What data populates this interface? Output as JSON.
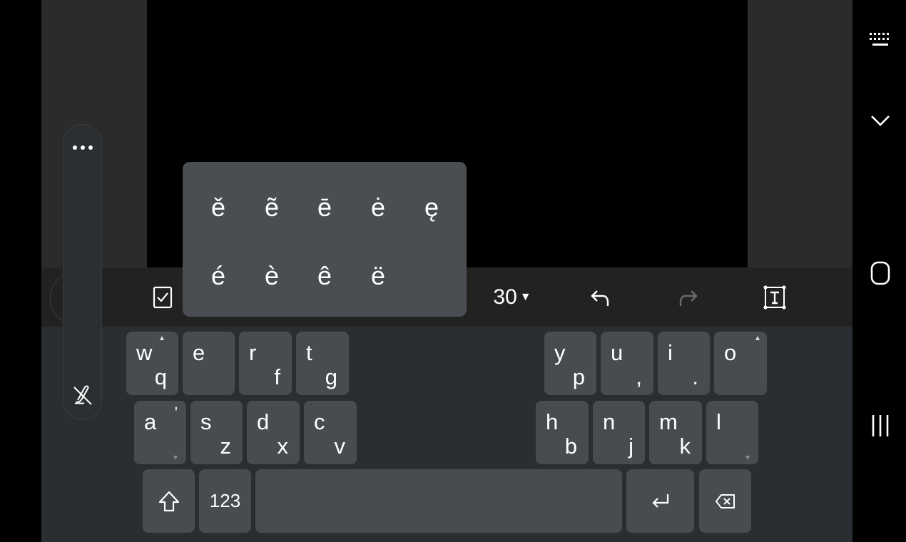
{
  "toolbar": {
    "font_size": "30",
    "icons": [
      "checkbox-icon",
      "undo-icon",
      "redo-icon",
      "text-box-icon"
    ]
  },
  "accent_popup": {
    "row1": [
      "ě",
      "ẽ",
      "ē",
      "ė",
      "ę"
    ],
    "row2": [
      "é",
      "è",
      "ê",
      "ë"
    ]
  },
  "keyboard": {
    "left_row1": [
      {
        "p": "w",
        "s": "q"
      },
      {
        "p": "e",
        "s": ""
      },
      {
        "p": "r",
        "s": "f"
      },
      {
        "p": "t",
        "s": "g"
      }
    ],
    "left_row2": [
      {
        "p": "a",
        "s": "'"
      },
      {
        "p": "s",
        "s": "z"
      },
      {
        "p": "d",
        "s": "x"
      },
      {
        "p": "c",
        "s": "v"
      }
    ],
    "right_row1": [
      {
        "p": "y",
        "s": "p"
      },
      {
        "p": "u",
        "s": ","
      },
      {
        "p": "i",
        "s": "."
      },
      {
        "p": "o",
        "s": ""
      }
    ],
    "right_row2": [
      {
        "p": "h",
        "s": "b"
      },
      {
        "p": "n",
        "s": "j"
      },
      {
        "p": "m",
        "s": "k"
      },
      {
        "p": "l",
        "s": ""
      }
    ],
    "numbers_label": "123"
  },
  "floating_bar": {
    "icons": [
      "more-icon",
      "draw-off-icon"
    ]
  },
  "nav": {
    "icons": [
      "keyboard-icon",
      "collapse-icon",
      "home-icon",
      "recents-icon"
    ]
  }
}
